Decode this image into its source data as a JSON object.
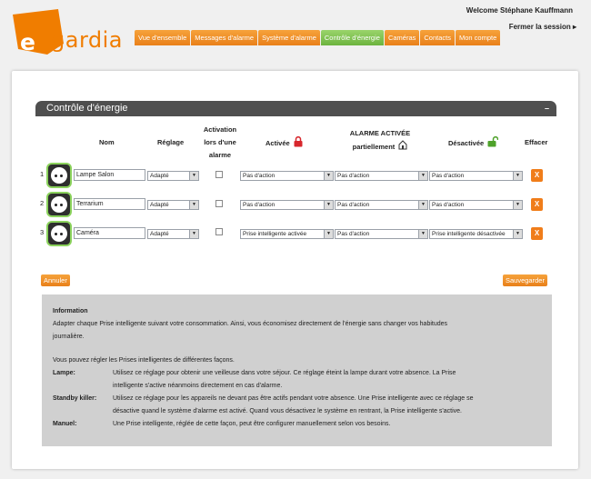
{
  "header": {
    "logo_text": "gardia",
    "logo_letter": "e",
    "welcome": "Welcome Stéphane Kauffmann",
    "logout": "Fermer la session ▸"
  },
  "nav": {
    "tabs": [
      {
        "label": "Vue d'ensemble"
      },
      {
        "label": "Messages d'alarme"
      },
      {
        "label": "Système d'alarme"
      },
      {
        "label": "Contrôle d'énergie"
      },
      {
        "label": "Caméras"
      },
      {
        "label": "Contacts"
      },
      {
        "label": "Mon compte"
      }
    ],
    "active_index": 3
  },
  "section": {
    "title": "Contrôle d'énergie",
    "minimize": "–"
  },
  "columns": {
    "nom": "Nom",
    "reglage": "Réglage",
    "activation_1": "Activation",
    "activation_2": "lors d'une",
    "activation_3": "alarme",
    "activee": "Activée",
    "partielle_1": "ALARME ACTIVÉE",
    "partielle_2": "partiellement",
    "desactivee": "Désactivée",
    "effacer": "Effacer"
  },
  "rows": [
    {
      "num": "1",
      "name": "Lampe Salon",
      "reglage": "Adapté",
      "activee": "Pas d'action",
      "partielle": "Pas d'action",
      "desactivee": "Pas d'action",
      "delete": "X"
    },
    {
      "num": "2",
      "name": "Terrarium",
      "reglage": "Adapté",
      "activee": "Pas d'action",
      "partielle": "Pas d'action",
      "desactivee": "Pas d'action",
      "delete": "X"
    },
    {
      "num": "3",
      "name": "Caméra",
      "reglage": "Adapté",
      "activee": "Prise intelligente activée",
      "partielle": "Pas d'action",
      "desactivee": "Prise intelligente désactivée",
      "delete": "X"
    }
  ],
  "buttons": {
    "cancel": "Annuler",
    "save": "Sauvegarder"
  },
  "info": {
    "title": "Information",
    "line1": "Adapter chaque Prise intelligente suivant votre consommation. Ainsi, vous économisez directement de l'énergie sans changer vos habitudes",
    "line2": "journalière.",
    "line3": "Vous pouvez régler les Prises intelligentes de différentes façons.",
    "lampe_label": "Lampe:",
    "lampe_1": "Utilisez ce réglage pour obtenir une veilleuse dans votre séjour. Ce réglage éteint la lampe durant votre absence. La Prise",
    "lampe_2": "intelligente s'active néanmoins directement en cas d'alarme.",
    "standby_label": "Standby killer:",
    "standby_1": "Utilisez ce réglage pour les appareils ne devant pas être actifs pendant votre absence. Une Prise intelligente avec ce réglage se",
    "standby_2": "désactive quand le système d'alarme est activé. Quand vous désactivez le système en rentrant, la Prise intelligente s'active.",
    "manuel_label": "Manuel:",
    "manuel_1": "Une Prise intelligente, réglée de cette façon, peut être configurer manuellement selon vos besoins."
  },
  "colors": {
    "brand_orange": "#f07d00",
    "active_green": "#6cb33e",
    "lock_red": "#d7262c"
  }
}
